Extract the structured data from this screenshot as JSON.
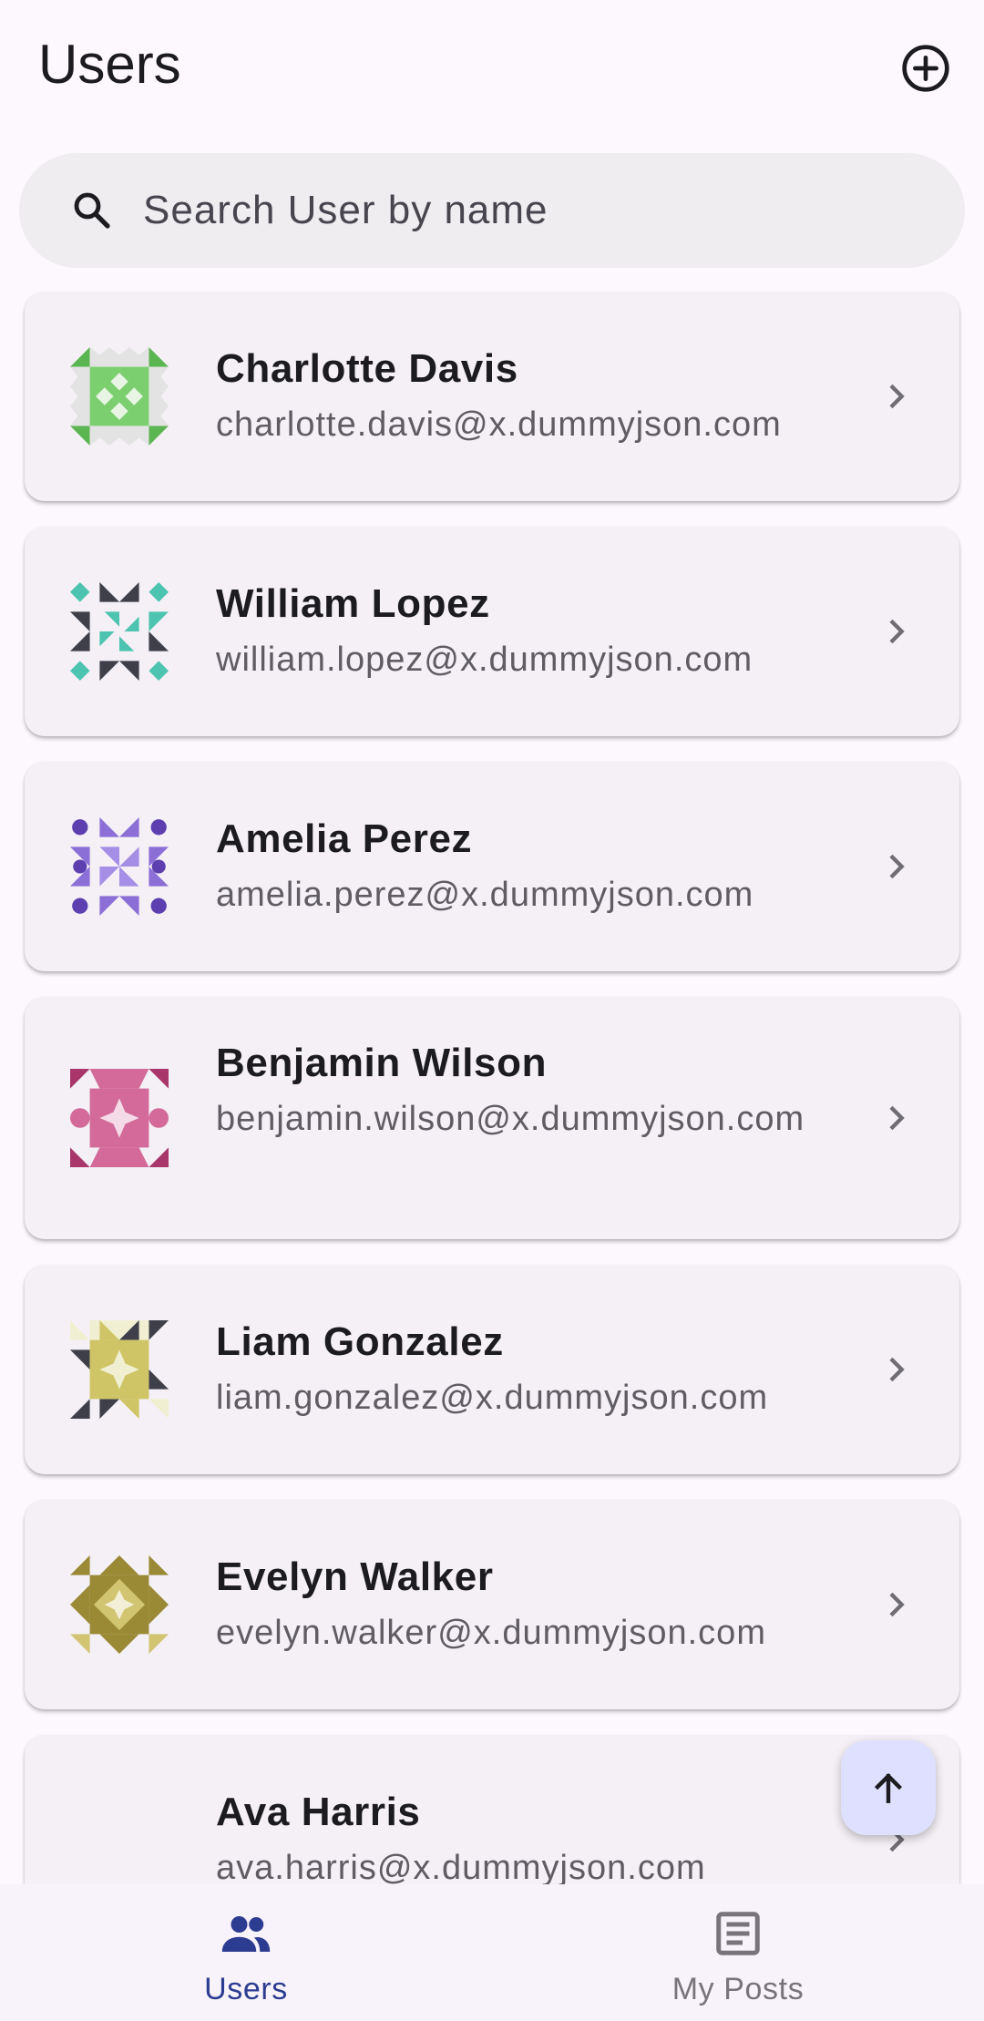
{
  "header": {
    "title": "Users",
    "add_icon": "add-circle-icon"
  },
  "search": {
    "placeholder": "Search User by name",
    "value": "",
    "icon": "search-icon"
  },
  "users": [
    {
      "name": "Charlotte Davis",
      "email": "charlotte.davis@x.dummyjson.com",
      "avatar_colors": [
        "#5bb551",
        "#e3e3e3"
      ]
    },
    {
      "name": "William Lopez",
      "email": "william.lopez@x.dummyjson.com",
      "avatar_colors": [
        "#4cc4b0",
        "#3f3f4a"
      ]
    },
    {
      "name": "Amelia Perez",
      "email": "amelia.perez@x.dummyjson.com",
      "avatar_colors": [
        "#8b6fd6",
        "#5d3fb0"
      ]
    },
    {
      "name": "Benjamin Wilson",
      "email": "benjamin.wilson@x.dummyjson.com",
      "avatar_colors": [
        "#d36a9a",
        "#a8366a"
      ]
    },
    {
      "name": "Liam Gonzalez",
      "email": "liam.gonzalez@x.dummyjson.com",
      "avatar_colors": [
        "#cfc566",
        "#3f3f4a"
      ]
    },
    {
      "name": "Evelyn Walker",
      "email": "evelyn.walker@x.dummyjson.com",
      "avatar_colors": [
        "#9a8a36",
        "#d2c572"
      ]
    },
    {
      "name": "Ava Harris",
      "email": "ava.harris@x.dummyjson.com",
      "avatar_colors": []
    }
  ],
  "fab": {
    "icon": "arrow-up-icon"
  },
  "bottom_nav": {
    "items": [
      {
        "label": "Users",
        "icon": "people-icon",
        "active": true
      },
      {
        "label": "My Posts",
        "icon": "article-icon",
        "active": false
      }
    ]
  },
  "colors": {
    "background": "#fdf8fe",
    "accent": "#2c3c91",
    "fab_bg": "#dfe0ff",
    "card_bg": "#f4f0f6"
  }
}
